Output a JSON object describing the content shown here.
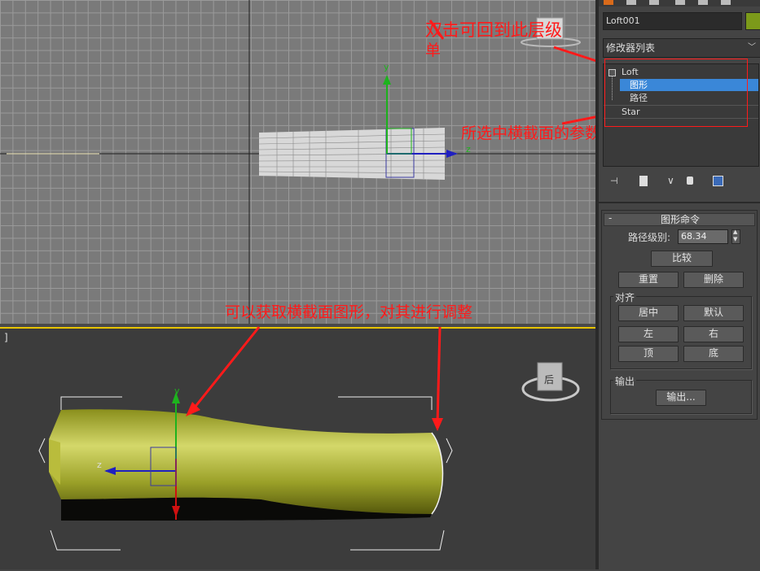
{
  "object_name": "Loft001",
  "object_color": "#7c9a1a",
  "modifier_list_label": "修改器列表",
  "stack": {
    "loft": "Loft",
    "shape": "图形",
    "path": "路径",
    "star": "Star"
  },
  "rollout": {
    "title": "图形命令",
    "collapse": "-",
    "path_level_label": "路径级别:",
    "path_level_value": "68.34",
    "compare": "比较",
    "reset": "重置",
    "delete": "删除",
    "align_title": "对齐",
    "center": "居中",
    "default": "默认",
    "left": "左",
    "right": "右",
    "top": "顶",
    "bottom": "底",
    "output_title": "输出",
    "output_button": "输出..."
  },
  "viewports": {
    "top_axis_y": "y",
    "top_axis_z": "z",
    "persp_axis_y": "y",
    "persp_axis_z": "z",
    "persp_label": "]",
    "viewcube_face": "后"
  },
  "annotations": {
    "click_return": "双击可回到此层级",
    "click_return_tail": "单",
    "selected_params": "所选中横截面的参数",
    "get_shape": "可以获取横截面图形，对其进行调整"
  },
  "colors": {
    "annotation": "#ff1a1a",
    "selection": "#3a87d8",
    "viewport_active": "#e8c400",
    "mesh": "#b8be2c"
  }
}
